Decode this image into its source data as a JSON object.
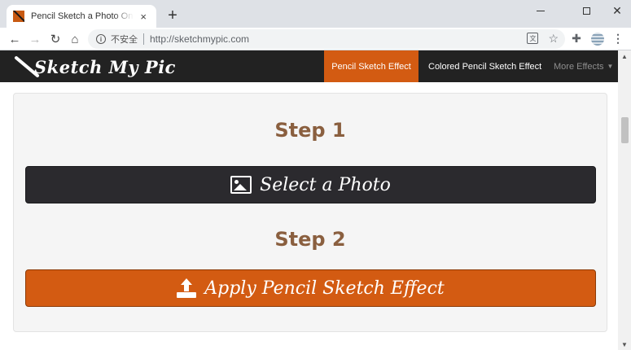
{
  "browser": {
    "tab_title": "Pencil Sketch a Photo Online Tool",
    "tab_close": "×",
    "new_tab": "+",
    "security_label": "不安全",
    "url": "http://sketchmypic.com"
  },
  "site": {
    "logo_text": "Sketch My Pic",
    "nav": {
      "pencil_sketch": "Pencil Sketch Effect",
      "colored_pencil": "Colored Pencil Sketch Effect",
      "more": "More Effects"
    },
    "step1_title": "Step 1",
    "select_photo_label": "Select a Photo",
    "step2_title": "Step 2",
    "apply_label": "Apply Pencil Sketch Effect"
  },
  "colors": {
    "accent": "#d35b12",
    "nav_bg": "#222222",
    "select_button_bg": "#2b2a2e",
    "step_title": "#8a5f3f"
  }
}
